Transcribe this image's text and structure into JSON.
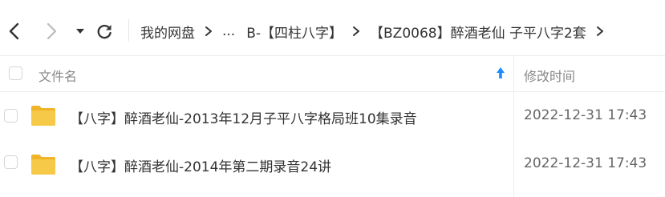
{
  "toolbar": {
    "icons": {
      "back": "chevron-left-icon",
      "forward": "chevron-right-icon",
      "dropdown": "caret-down-icon",
      "refresh": "refresh-icon"
    }
  },
  "breadcrumbs": [
    "我的网盘",
    "...",
    "B-【四柱八字】",
    "【BZ0068】醉酒老仙 子平八字2套"
  ],
  "table": {
    "columns": {
      "name": "文件名",
      "modified": "修改时间"
    },
    "sort_icon": "sort-up-arrow-icon",
    "rows": [
      {
        "name": "【八字】醉酒老仙-2013年12月子平八字格局班10集录音",
        "modified": "2022-12-31 17:43",
        "icon": "folder-icon"
      },
      {
        "name": "【八字】醉酒老仙-2014年第二期录音24讲",
        "modified": "2022-12-31 17:43",
        "icon": "folder-icon"
      }
    ]
  },
  "colors": {
    "accent": "#1a8cff",
    "folder": "#f5c03a"
  }
}
